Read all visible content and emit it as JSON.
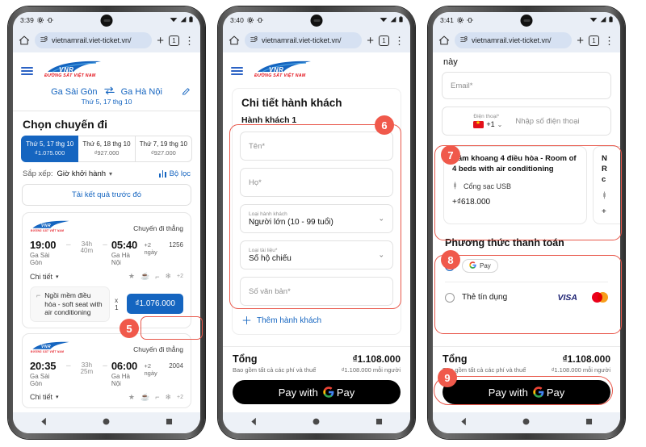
{
  "phones": [
    {
      "status": {
        "time": "3:39",
        "icons": [
          "gear-icon",
          "vibrate-icon"
        ],
        "right_icons": [
          "wifi-icon",
          "signal-icon",
          "battery-icon"
        ]
      },
      "browser": {
        "url": "vietnamrail.viet-ticket.vn/",
        "tab_count": "1",
        "new_tab_label": "+",
        "menu_label": "⋮"
      }
    },
    {
      "status": {
        "time": "3:40",
        "icons": [
          "gear-icon",
          "vibrate-icon"
        ],
        "right_icons": [
          "wifi-icon",
          "signal-icon",
          "battery-icon"
        ]
      },
      "browser": {
        "url": "vietnamrail.viet-ticket.vn/",
        "tab_count": "1",
        "new_tab_label": "+",
        "menu_label": "⋮"
      }
    },
    {
      "status": {
        "time": "3:41",
        "icons": [
          "gear-icon",
          "vibrate-icon"
        ],
        "right_icons": [
          "wifi-icon",
          "signal-icon",
          "battery-icon"
        ]
      },
      "browser": {
        "url": "vietnamrail.viet-ticket.vn/",
        "tab_count": "1",
        "new_tab_label": "+",
        "menu_label": "⋮"
      }
    }
  ],
  "brand": {
    "logo_main": "VNR",
    "logo_sub": "ĐƯỜNG SẮT VIỆT NAM"
  },
  "screen1": {
    "route": {
      "from": "Ga Sài Gòn",
      "to": "Ga Hà Nội",
      "swap_icon": "swap-icon",
      "date": "Thứ 5, 17 thg 10",
      "edit_icon": "pencil-icon"
    },
    "heading": "Chọn chuyến đi",
    "day_tabs": [
      {
        "day": "Thứ 5, 17 thg 10",
        "price": "₫1.075.000",
        "active": true
      },
      {
        "day": "Thứ 6, 18 thg 10",
        "price": "₫927.000",
        "active": false
      },
      {
        "day": "Thứ 7, 19 thg 10",
        "price": "₫927.000",
        "active": false
      }
    ],
    "sort": {
      "label": "Sắp xếp:",
      "value": "Giờ khởi hành",
      "filter_label": "Bộ lọc"
    },
    "reload_label": "Tải kết quả trước đó",
    "trips": [
      {
        "direct_label": "Chuyến đi thẳng",
        "depart_time": "19:00",
        "depart_station": "Ga Sài Gòn",
        "duration": "34h 40m",
        "arrive_time": "05:40",
        "arrive_station": "Ga Hà Nội",
        "plus_days": "+2 ngày",
        "train_no": "1256",
        "detail_label": "Chi tiết",
        "amenities_more": "+2",
        "seat_label": "Ngồi mềm điều hòa - soft seat with air conditioning",
        "seat_qty": "x 1",
        "price": "₫1.076.000"
      },
      {
        "direct_label": "Chuyến đi thẳng",
        "depart_time": "20:35",
        "depart_station": "Ga Sài Gòn",
        "duration": "33h 25m",
        "arrive_time": "06:00",
        "arrive_station": "Ga Hà Nội",
        "plus_days": "+2 ngày",
        "train_no": "2004",
        "detail_label": "Chi tiết",
        "amenities_more": "+2"
      }
    ]
  },
  "screen2": {
    "title": "Chi tiết hành khách",
    "passenger_label": "Hành khách 1",
    "fields": [
      {
        "type": "input",
        "placeholder": "Tên*",
        "value": ""
      },
      {
        "type": "input",
        "placeholder": "Họ*",
        "value": ""
      },
      {
        "type": "select",
        "label": "Loại hành khách",
        "value": "Người lớn (10 - 99 tuổi)"
      },
      {
        "type": "select",
        "label": "Loại tài liệu*",
        "value": "Số hộ chiếu"
      },
      {
        "type": "input",
        "placeholder": "Số văn bản*",
        "value": ""
      }
    ],
    "add_passenger": "Thêm hành khách",
    "total": {
      "label": "Tổng",
      "note": "Bao gồm tất cả các phí và thuế",
      "amount": "₫1.108.000",
      "per_person": "₫1.108.000 mỗi người"
    },
    "pay_button": {
      "prefix": "Pay with",
      "brand": "Pay",
      "icon": "google-g-icon"
    }
  },
  "screen3": {
    "top_text": "này",
    "email_field": {
      "placeholder": "Email*",
      "value": ""
    },
    "phone_field": {
      "label": "Điện thoại*",
      "country_code": "+1",
      "placeholder": "Nhập số điện thoại",
      "flag": "vn-flag-icon"
    },
    "room_card": {
      "title": "Nằm khoang 4 điều hòa - Room of 4 beds with air conditioning",
      "amenity": "Cổng sạc USB",
      "amenity_icon": "usb-icon",
      "price": "+₫618.000"
    },
    "room_card_partial": {
      "line1": "N",
      "line2": "R",
      "line3": "c",
      "amenity_icon": "usb-icon",
      "price": "+"
    },
    "payment": {
      "title": "Phương thức thanh toán",
      "options": [
        {
          "label": "Pay",
          "icon": "google-g-icon",
          "selected": true,
          "type": "gpay"
        },
        {
          "label": "Thẻ tín dụng",
          "selected": false,
          "type": "card",
          "brands": [
            "visa-icon",
            "mastercard-icon"
          ]
        }
      ]
    },
    "total": {
      "label": "Tổng",
      "note": "Bao gồm tất cả các phí và thuế",
      "amount": "₫1.108.000",
      "per_person": "₫1.108.000 mỗi người"
    },
    "pay_button": {
      "prefix": "Pay with",
      "brand": "Pay",
      "icon": "google-g-icon"
    }
  },
  "annotations": [
    {
      "number": "5"
    },
    {
      "number": "6"
    },
    {
      "number": "7"
    },
    {
      "number": "8"
    },
    {
      "number": "9"
    }
  ],
  "colors": {
    "accent_blue": "#1565c0",
    "annotation_red": "#f0594b",
    "brand_red": "#e3101a",
    "black": "#000000"
  }
}
